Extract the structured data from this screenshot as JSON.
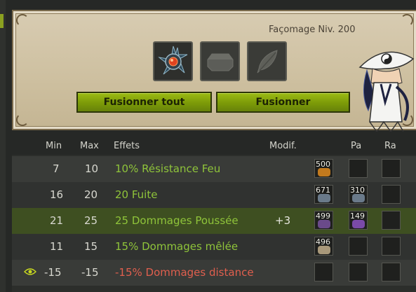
{
  "header": {
    "craft_label": "Façomage Niv. 200"
  },
  "slots": {
    "slot1_icon": "spiked-item-icon",
    "slot2_icon": "rune-stone-icon",
    "slot3_icon": "feather-icon"
  },
  "buttons": {
    "fuse_all": "Fusionner tout",
    "fuse": "Fusionner"
  },
  "table": {
    "columns": {
      "min": "Min",
      "max": "Max",
      "effects": "Effets",
      "modif": "Modif.",
      "pa": "Pa",
      "ra": "Ra"
    },
    "rows": [
      {
        "min": "7",
        "max": "10",
        "effect": "10% Résistance Feu",
        "modif": "",
        "rune_qty": "500",
        "pa_qty": "",
        "ra_qty": "",
        "negative": false
      },
      {
        "min": "16",
        "max": "20",
        "effect": "20 Fuite",
        "modif": "",
        "rune_qty": "671",
        "pa_qty": "310",
        "ra_qty": "",
        "negative": false
      },
      {
        "min": "21",
        "max": "25",
        "effect": "25 Dommages Poussée",
        "modif": "+3",
        "rune_qty": "499",
        "pa_qty": "149",
        "ra_qty": "",
        "negative": false
      },
      {
        "min": "11",
        "max": "15",
        "effect": "15% Dommages mêlée",
        "modif": "",
        "rune_qty": "496",
        "pa_qty": "",
        "ra_qty": "",
        "negative": false
      },
      {
        "min": "-15",
        "max": "-15",
        "effect": "-15% Dommages distance",
        "modif": "",
        "rune_qty": "",
        "pa_qty": "",
        "ra_qty": "",
        "negative": true
      }
    ]
  },
  "colors": {
    "positive_effect": "#8fc43a",
    "negative_effect": "#e05f4e",
    "button_green": "#7c9a08",
    "selected_row": "#3e4f21"
  }
}
